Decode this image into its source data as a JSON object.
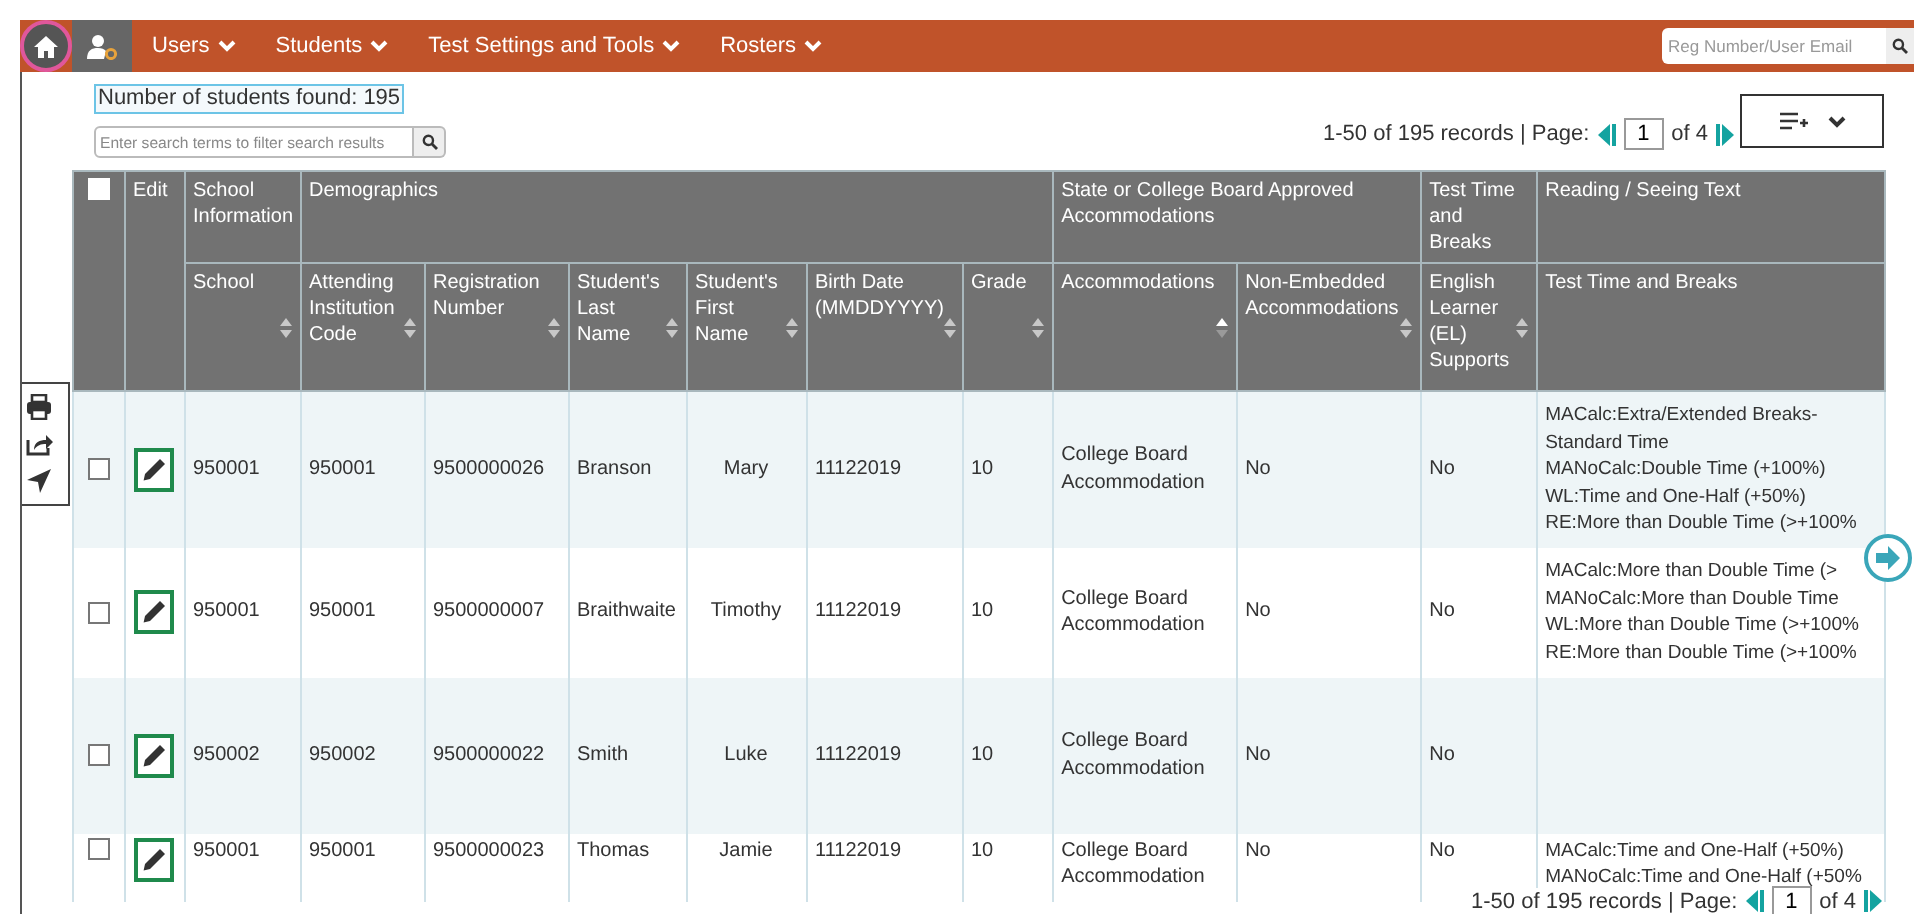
{
  "nav": {
    "home": {
      "focused": true
    },
    "menus": [
      {
        "label": "Users"
      },
      {
        "label": "Students"
      },
      {
        "label": "Test Settings and Tools"
      },
      {
        "label": "Rosters"
      }
    ],
    "search": {
      "placeholder": "Reg Number/User Email"
    }
  },
  "results": {
    "count": "Number of students found: 195",
    "filter": {
      "placeholder": "Enter search terms to filter search results"
    }
  },
  "pager_top": {
    "summary": "1-50 of 195 records | Page:",
    "page": "1",
    "total": "of 4"
  },
  "table": {
    "select_all": {
      "checked": false
    },
    "edit_header": "Edit",
    "groups": [
      {
        "label": "School Information",
        "columns": [
          {
            "label": "School",
            "sorted": false
          }
        ]
      },
      {
        "label": "Demographics",
        "columns": [
          {
            "label": "Attending Institution Code",
            "sorted": false
          },
          {
            "label": "Registration Number",
            "sorted": false
          },
          {
            "label": "Student's Last Name",
            "sorted": false
          },
          {
            "label": "Student's First Name",
            "sorted": false
          },
          {
            "label": "Birth Date (MMDDYYYY)",
            "sorted": false
          },
          {
            "label": "Grade",
            "sorted": false
          }
        ]
      },
      {
        "label": "State or College Board Approved Accommodations",
        "columns": [
          {
            "label": "Accommodations",
            "sorted": true
          },
          {
            "label": "Non-Embedded Accommodations",
            "sorted": false
          }
        ]
      },
      {
        "label": "Test Time and Breaks",
        "columns": [
          {
            "label": "English Learner (EL) Supports",
            "sorted": false
          }
        ]
      },
      {
        "label": "Reading / Seeing Text",
        "columns": [
          {
            "label": "Test Time and Breaks"
          }
        ]
      }
    ],
    "rows": [
      {
        "checked": false,
        "cells": [
          "950001",
          "950001",
          "9500000026",
          "Branson",
          "Mary",
          "11122019",
          "10",
          "College Board Accommodation",
          "No",
          "No"
        ],
        "test_time": [
          "MACalc:Extra/Extended Breaks-Standard Time",
          "MANoCalc:Double Time (+100%)",
          "WL:Time and One-Half (+50%)",
          "RE:More than Double Time (>+100%"
        ]
      },
      {
        "checked": false,
        "cells": [
          "950001",
          "950001",
          "9500000007",
          "Braithwaite",
          "Timothy",
          "11122019",
          "10",
          "College Board Accommodation",
          "No",
          "No"
        ],
        "test_time": [
          "MACalc:More than Double Time (>",
          "MANoCalc:More than Double Time",
          "WL:More than Double Time (>+100%",
          "RE:More than Double Time (>+100%"
        ]
      },
      {
        "checked": false,
        "cells": [
          "950002",
          "950002",
          "9500000022",
          "Smith",
          "Luke",
          "11122019",
          "10",
          "College Board Accommodation",
          "No",
          "No"
        ],
        "test_time": []
      },
      {
        "checked": false,
        "cells": [
          "950001",
          "950001",
          "9500000023",
          "Thomas",
          "Jamie",
          "11122019",
          "10",
          "College Board Accommodation",
          "No",
          "No"
        ],
        "test_time": [
          "MACalc:Time and One-Half (+50%)",
          "MANoCalc:Time and One-Half (+50%"
        ]
      }
    ]
  },
  "pager_bottom": {
    "summary": "1-50 of 195 records | Page:",
    "page": "1",
    "total": "of 4"
  }
}
